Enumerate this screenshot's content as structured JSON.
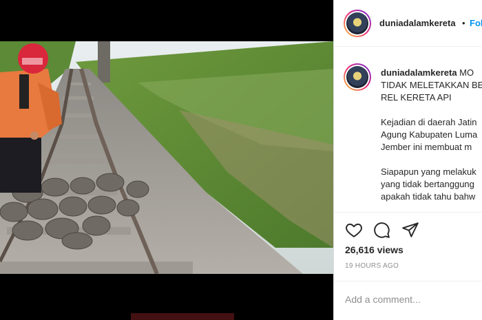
{
  "post": {
    "username": "duniadalamkereta",
    "separator": "•",
    "follow_label": "Follow",
    "caption_lines": [
      "MO",
      "TIDAK MELETAKKAN BE",
      "REL KERETA API",
      "",
      "Kejadian di daerah Jatin",
      "Agung Kabupaten Luma",
      "Jember ini membuat m",
      "",
      "Siapapun yang melakuk",
      "yang tidak bertanggung",
      "apakah tidak tahu bahw"
    ],
    "views": "26,616 views",
    "time_ago": "19 HOURS AGO",
    "comment_placeholder": "Add a comment..."
  },
  "icons": {
    "like": "heart-icon",
    "comment": "comment-icon",
    "share": "paper-plane-icon",
    "avatar": "profile-avatar"
  },
  "colors": {
    "accent": "#0095f6",
    "text": "#262626",
    "muted": "#8e8e8e",
    "border": "#dbdbdb"
  }
}
